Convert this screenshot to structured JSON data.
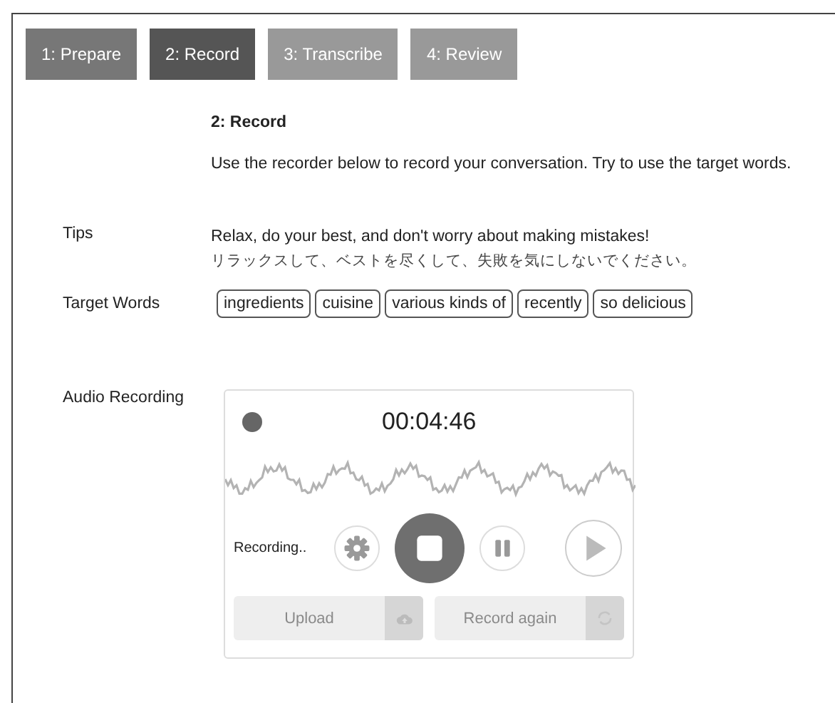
{
  "tabs": [
    {
      "label": "1: Prepare",
      "selected": false,
      "disabled": false
    },
    {
      "label": "2: Record",
      "selected": true,
      "disabled": false
    },
    {
      "label": "3: Transcribe",
      "selected": false,
      "disabled": true
    },
    {
      "label": "4: Review",
      "selected": false,
      "disabled": true
    }
  ],
  "heading": "2: Record",
  "description": "Use the recorder below to record your conversation. Try to use the target words.",
  "tips": {
    "label": "Tips",
    "lines": [
      "Relax, do your best, and don't worry about making mistakes!",
      "リラックスして、ベストを尽くして、失敗を気にしないでください。"
    ]
  },
  "target_words": {
    "label": "Target Words",
    "words": [
      "ingredients",
      "cuisine",
      "various kinds of",
      "recently",
      "so delicious"
    ]
  },
  "audio": {
    "label": "Audio Recording",
    "recorder": {
      "recording": true,
      "time": "00:04:46",
      "status": "Recording..",
      "actions": [
        {
          "label": "Upload",
          "kind": "upload",
          "disabled": true
        },
        {
          "label": "Record again",
          "kind": "redo",
          "disabled": true
        }
      ]
    }
  }
}
